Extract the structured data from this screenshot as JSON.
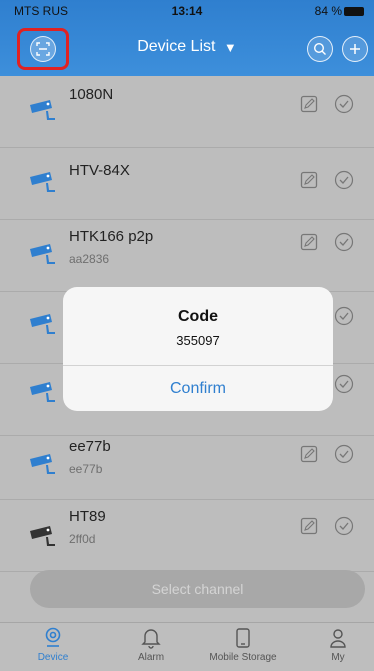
{
  "status_bar": {
    "carrier": "MTS RUS",
    "time": "13:14",
    "battery": "84 %"
  },
  "header": {
    "title": "Device List",
    "dropdown_glyph": "▼"
  },
  "devices": [
    {
      "name": "1080N",
      "sub": "",
      "camera_color": "#2f7fcf"
    },
    {
      "name": "HTV-84X",
      "sub": "",
      "camera_color": "#2f7fcf"
    },
    {
      "name": "HTK166 p2p",
      "sub": "aa2836",
      "camera_color": "#2f7fcf"
    },
    {
      "name": "",
      "sub": "",
      "camera_color": "#2f7fcf"
    },
    {
      "name": "",
      "sub": "",
      "camera_color": "#2f7fcf"
    },
    {
      "name": "ee77b",
      "sub": "ee77b",
      "camera_color": "#2f7fcf"
    },
    {
      "name": "HT89",
      "sub": "2ff0d",
      "camera_color": "#333333"
    }
  ],
  "select_channel": "Select channel",
  "tabs": [
    {
      "label": "Device",
      "icon": "device-icon",
      "active": true
    },
    {
      "label": "Alarm",
      "icon": "bell-icon",
      "active": false
    },
    {
      "label": "Mobile Storage",
      "icon": "phone-icon",
      "active": false
    },
    {
      "label": "My",
      "icon": "user-icon",
      "active": false
    }
  ],
  "modal": {
    "title": "Code",
    "code": "355097",
    "confirm": "Confirm"
  },
  "colors": {
    "accent": "#2f7fcf",
    "highlight": "#e02222"
  }
}
